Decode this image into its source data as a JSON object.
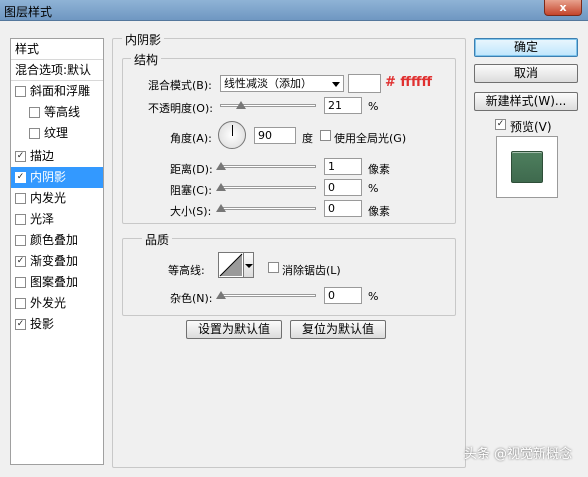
{
  "window": {
    "title": "图层样式",
    "close": "x"
  },
  "sidebar": {
    "items": [
      {
        "label": "样式",
        "type": "head"
      },
      {
        "label": "混合选项:默认",
        "type": "head"
      },
      {
        "label": "斜面和浮雕",
        "checked": false,
        "indent": 0
      },
      {
        "label": "等高线",
        "checked": false,
        "indent": 1
      },
      {
        "label": "纹理",
        "checked": false,
        "indent": 1
      },
      {
        "label": "描边",
        "checked": true,
        "indent": 0
      },
      {
        "label": "内阴影",
        "checked": true,
        "indent": 0,
        "selected": true
      },
      {
        "label": "内发光",
        "checked": false,
        "indent": 0
      },
      {
        "label": "光泽",
        "checked": false,
        "indent": 0
      },
      {
        "label": "颜色叠加",
        "checked": false,
        "indent": 0
      },
      {
        "label": "渐变叠加",
        "checked": true,
        "indent": 0
      },
      {
        "label": "图案叠加",
        "checked": false,
        "indent": 0
      },
      {
        "label": "外发光",
        "checked": false,
        "indent": 0
      },
      {
        "label": "投影",
        "checked": true,
        "indent": 0
      }
    ]
  },
  "panel": {
    "title": "内阴影",
    "structure": {
      "legend": "结构",
      "blend_label": "混合模式(B):",
      "blend_value": "线性减淡（添加）",
      "color_value": "#ffffff",
      "color_annotation": "# ffffff",
      "opacity_label": "不透明度(O):",
      "opacity_value": "21",
      "opacity_unit": "%",
      "angle_label": "角度(A):",
      "angle_value": "90",
      "angle_unit": "度",
      "global_light_label": "使用全局光(G)",
      "global_light_checked": false,
      "distance_label": "距离(D):",
      "distance_value": "1",
      "distance_unit": "像素",
      "choke_label": "阻塞(C):",
      "choke_value": "0",
      "choke_unit": "%",
      "size_label": "大小(S):",
      "size_value": "0",
      "size_unit": "像素"
    },
    "quality": {
      "legend": "品质",
      "contour_label": "等高线:",
      "antialias_label": "消除锯齿(L)",
      "antialias_checked": false,
      "noise_label": "杂色(N):",
      "noise_value": "0",
      "noise_unit": "%"
    },
    "set_default": "设置为默认值",
    "reset_default": "复位为默认值"
  },
  "buttons": {
    "ok": "确定",
    "cancel": "取消",
    "new_style": "新建样式(W)...",
    "preview_label": "预览(V)",
    "preview_checked": true
  },
  "slider_levels": {
    "opacity": 0.21,
    "distance": 0.0,
    "choke": 0.0,
    "size": 0.0,
    "noise": 0.0
  },
  "colors": {
    "accent": "#3399ff",
    "annotation": "#e03030",
    "preview_swatch": "#4e7f5e"
  },
  "watermark": "头条 @视觉新概念"
}
